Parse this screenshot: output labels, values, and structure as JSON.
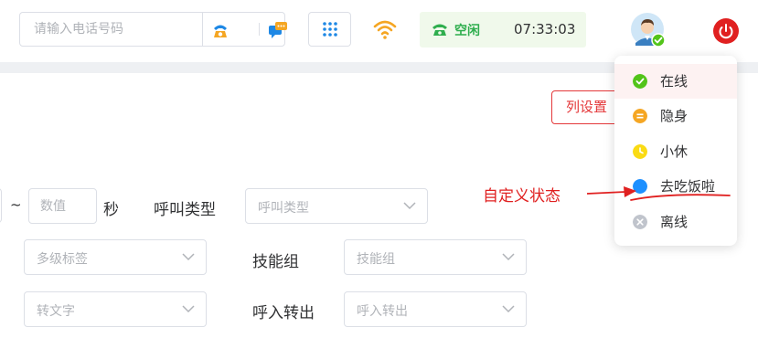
{
  "header": {
    "phone_placeholder": "请输入电话号码",
    "status_label": "空闲",
    "time": "07:33:03"
  },
  "main": {
    "column_settings_label": "列设置",
    "duration_placeholder": "数值",
    "tilde": "~",
    "seconds_unit": "秒",
    "call_type_label": "呼叫类型",
    "call_type_placeholder": "呼叫类型",
    "multi_tag_placeholder": "多级标签",
    "skill_group_label": "技能组",
    "skill_group_placeholder": "技能组",
    "transcribe_placeholder": "转文字",
    "in_out_label": "呼入转出",
    "in_out_placeholder": "呼入转出"
  },
  "status_menu": {
    "items": [
      {
        "label": "在线",
        "color": "#52c41a",
        "icon": "check-icon"
      },
      {
        "label": "隐身",
        "color": "#f5a623",
        "icon": "equals-icon"
      },
      {
        "label": "小休",
        "color": "#fadb14",
        "icon": "clock-icon"
      },
      {
        "label": "去吃饭啦",
        "color": "#1e90ff",
        "icon": "dot-icon"
      },
      {
        "label": "离线",
        "color": "#c0c4cc",
        "icon": "x-icon"
      }
    ]
  },
  "annotation": {
    "text": "自定义状态"
  },
  "colors": {
    "accent_red": "#e4383a",
    "idle_green": "#2fae4e",
    "annotation_red": "#e02020"
  }
}
